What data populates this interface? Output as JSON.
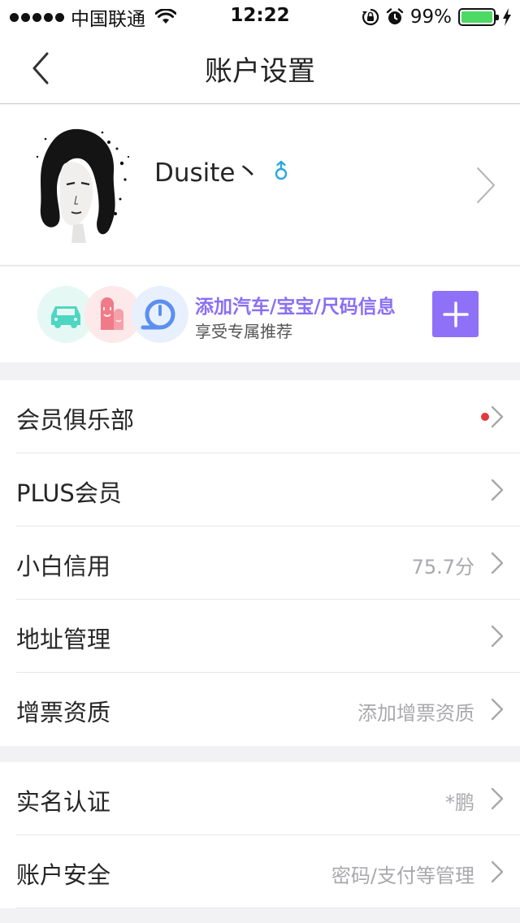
{
  "status_bar": {
    "carrier": "中国联通",
    "time": "12:22",
    "battery_percent": "99%",
    "battery_level": 0.99,
    "battery_color": "#4cd964",
    "icons": [
      "signal-dots-icon",
      "wifi-icon",
      "rotation-lock-icon",
      "alarm-icon",
      "battery-icon",
      "charging-bolt-icon"
    ]
  },
  "nav": {
    "title": "账户设置",
    "back_icon": "chevron-left-icon"
  },
  "profile": {
    "username": "Dusite丶",
    "gender_icon": "male-icon",
    "gender_color": "#28a8e0"
  },
  "promo": {
    "title": "添加汽车/宝宝/尺码信息",
    "subtitle": "享受专属推荐",
    "accent_color": "#8f71f8",
    "icons": [
      "car-icon",
      "baby-icon",
      "measure-tape-icon"
    ]
  },
  "settings_groups": [
    {
      "rows": [
        {
          "label": "会员俱乐部",
          "value": "",
          "has_dot": true
        },
        {
          "label": "PLUS会员",
          "value": ""
        },
        {
          "label": "小白信用",
          "value": "75.7分"
        },
        {
          "label": "地址管理",
          "value": ""
        },
        {
          "label": "增票资质",
          "value": "添加增票资质"
        }
      ]
    },
    {
      "rows": [
        {
          "label": "实名认证",
          "value": "*鹏"
        },
        {
          "label": "账户安全",
          "value": "密码/支付等管理"
        }
      ]
    }
  ]
}
